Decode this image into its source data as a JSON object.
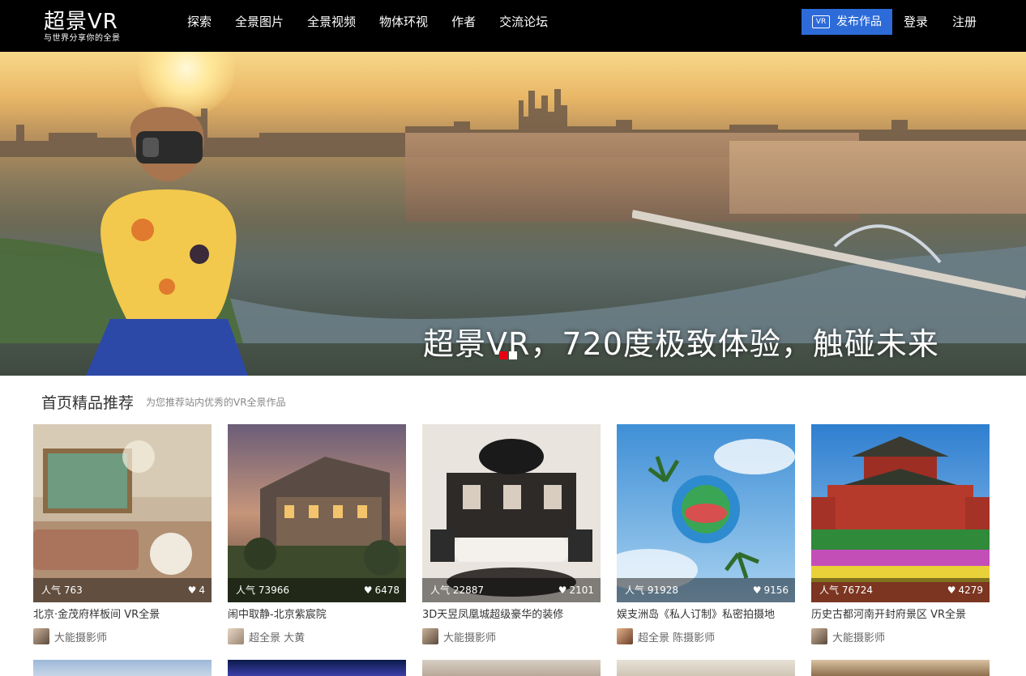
{
  "header": {
    "logo_main": "超景VR",
    "logo_sub": "与世界分享你的全景",
    "nav": [
      "探索",
      "全景图片",
      "全景视频",
      "物体环视",
      "作者",
      "交流论坛"
    ],
    "publish_badge": "VR",
    "publish_label": "发布作品",
    "login_label": "登录",
    "register_label": "注册"
  },
  "banner": {
    "slogan": "超景VR，720度极致体验，触碰未来",
    "slides_total": 2,
    "active_slide": 1
  },
  "section": {
    "title": "首页精品推荐",
    "subtitle": "为您推荐站内优秀的VR全景作品"
  },
  "cards": [
    {
      "title": "北京·金茂府样板间 VR全景",
      "popularity": "人气 763",
      "likes": "4",
      "author": "大能摄影师"
    },
    {
      "title": "闹中取静-北京紫宸院",
      "popularity": "人气 73966",
      "likes": "6478",
      "author": "超全景 大黄"
    },
    {
      "title": "3D天昱凤凰城超级豪华的装修",
      "popularity": "人气 22887",
      "likes": "2101",
      "author": "大能摄影师"
    },
    {
      "title": "娱支洲岛《私人订制》私密拍摄地",
      "popularity": "人气 91928",
      "likes": "9156",
      "author": "超全景 陈摄影师"
    },
    {
      "title": "历史古都河南开封府景区 VR全景",
      "popularity": "人气 76724",
      "likes": "4279",
      "author": "大能摄影师"
    }
  ],
  "colors": {
    "header_bg": "#000000",
    "publish_bg": "#2d6bd8",
    "active_dot": "#e60012"
  }
}
